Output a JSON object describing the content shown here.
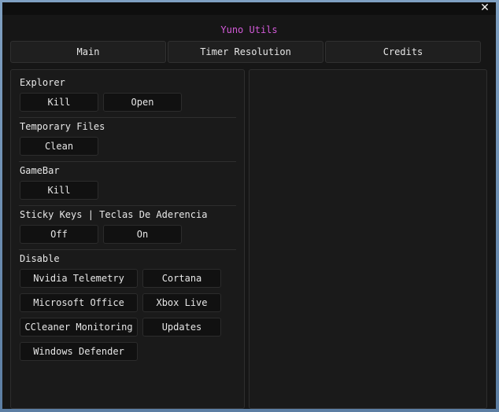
{
  "window": {
    "close_glyph": "✕"
  },
  "app": {
    "title": "Yuno Utils",
    "title_color": "#d25ad8"
  },
  "tabs": [
    {
      "label": "Main"
    },
    {
      "label": "Timer Resolution"
    },
    {
      "label": "Credits"
    }
  ],
  "sections": {
    "explorer": {
      "label": "Explorer",
      "buttons": [
        "Kill",
        "Open"
      ]
    },
    "temp_files": {
      "label": "Temporary Files",
      "buttons": [
        "Clean"
      ]
    },
    "gamebar": {
      "label": "GameBar",
      "buttons": [
        "Kill"
      ]
    },
    "sticky_keys": {
      "label": "Sticky Keys | Teclas De Aderencia",
      "buttons": [
        "Off",
        "On"
      ]
    },
    "disable": {
      "label": "Disable",
      "buttons": [
        "Nvidia Telemetry",
        "Cortana",
        "Microsoft Office",
        "Xbox Live",
        "CCleaner Monitoring",
        "Updates",
        "Windows Defender"
      ]
    }
  }
}
